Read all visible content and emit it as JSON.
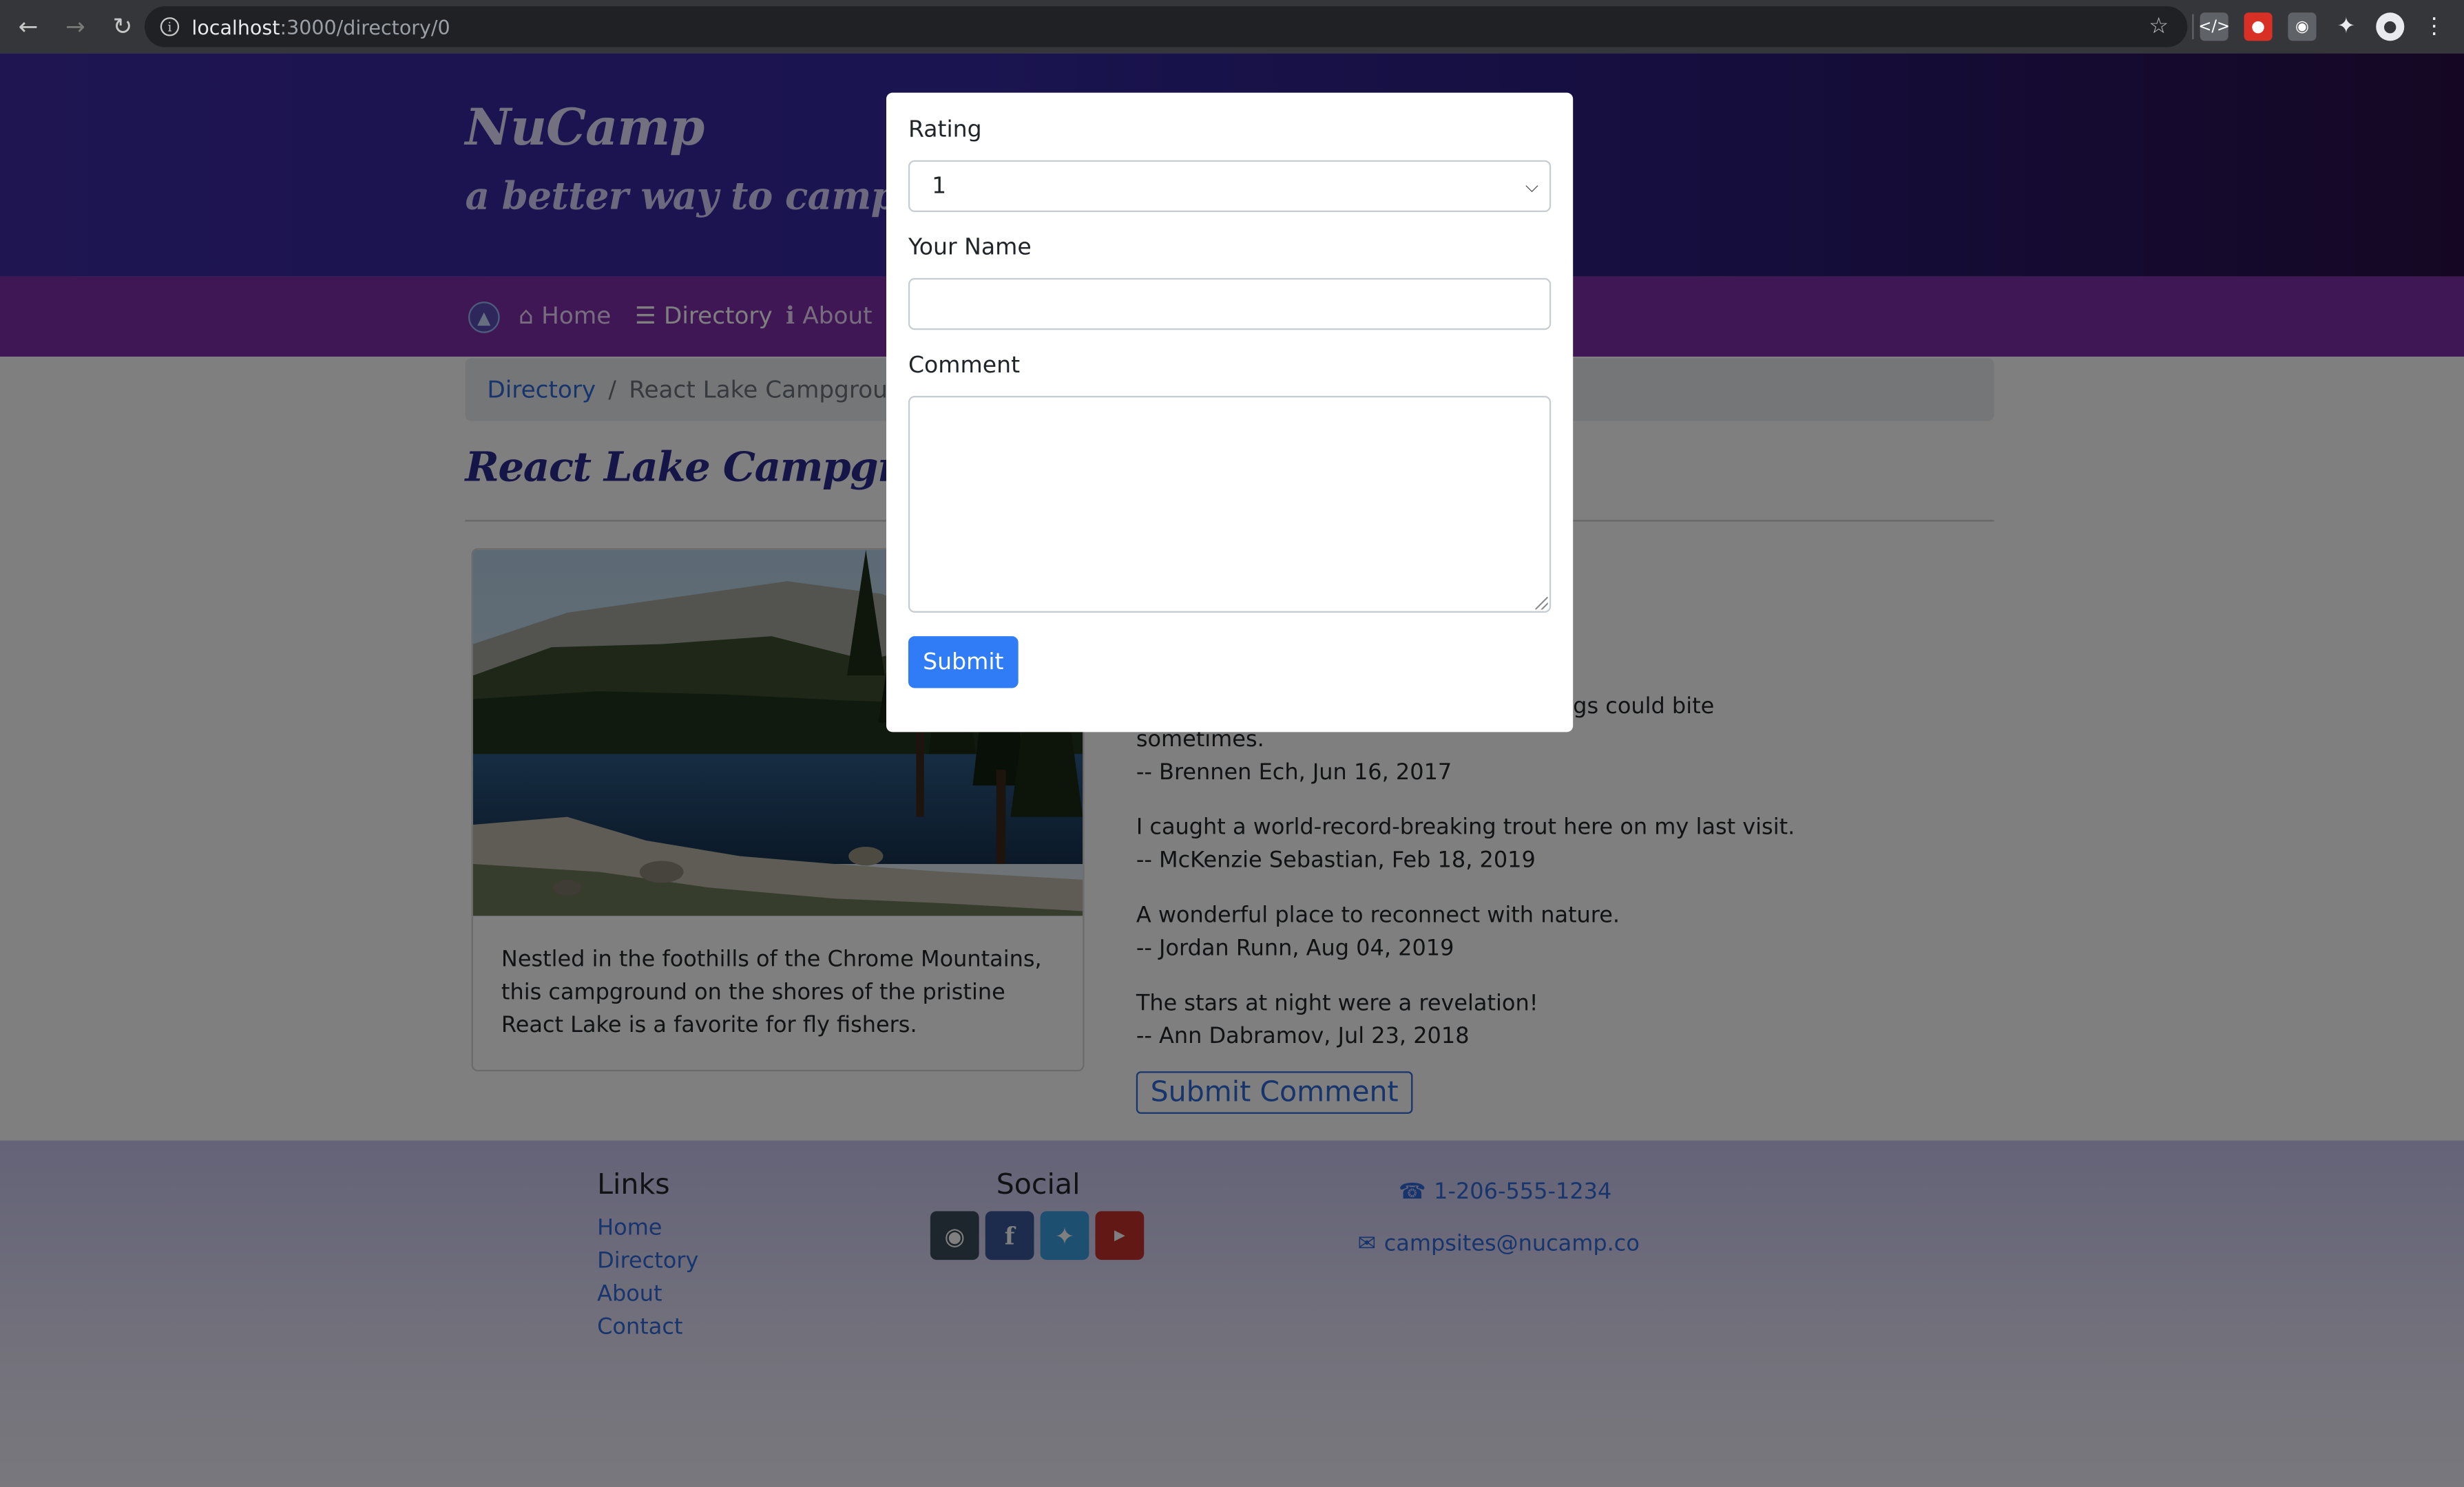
{
  "browser": {
    "url_host": "localhost",
    "url_path": ":3000/directory/0",
    "back_icon": "arrow-left-icon",
    "forward_icon": "arrow-right-icon",
    "reload_icon": "reload-icon",
    "bookmark_icon": "star-icon",
    "menu_icon": "kebab-menu-icon"
  },
  "header": {
    "brand": "NuCamp",
    "tagline": "a better way to camp"
  },
  "nav": {
    "items": [
      {
        "label": "Home",
        "icon": "home-icon"
      },
      {
        "label": "Directory",
        "icon": "list-icon",
        "active": true
      },
      {
        "label": "About",
        "icon": "info-icon"
      }
    ]
  },
  "breadcrumb": {
    "link": "Directory",
    "separator": "/",
    "current": "React Lake Campground"
  },
  "page": {
    "title": "React Lake Campground"
  },
  "campsite": {
    "description": "Nestled in the foothills of the Chrome Mountains, this campground on the shores of the pristine React Lake is a favorite for fly fishers."
  },
  "comments": {
    "partial_line_1": "gs could bite",
    "partial_line_2": "sometimes.",
    "items": [
      {
        "text": "",
        "author": "-- Brennen Ech, Jun 16, 2017"
      },
      {
        "text": "I caught a world-record-breaking trout here on my last visit.",
        "author": "-- McKenzie Sebastian, Feb 18, 2019"
      },
      {
        "text": "A wonderful place to reconnect with nature.",
        "author": "-- Jordan Runn, Aug 04, 2019"
      },
      {
        "text": "The stars at night were a revelation!",
        "author": "-- Ann Dabramov, Jul 23, 2018"
      }
    ],
    "submit_label": "Submit Comment"
  },
  "footer": {
    "links_heading": "Links",
    "links": [
      "Home",
      "Directory",
      "About",
      "Contact"
    ],
    "social_heading": "Social",
    "social": [
      "instagram-icon",
      "facebook-icon",
      "twitter-icon",
      "youtube-icon"
    ],
    "phone": "1-206-555-1234",
    "email": "campsites@nucamp.co"
  },
  "modal": {
    "rating_label": "Rating",
    "rating_value": "1",
    "name_label": "Your Name",
    "name_value": "",
    "comment_label": "Comment",
    "comment_value": "",
    "submit_label": "Submit"
  },
  "colors": {
    "link": "#2f6bd8",
    "navbar": "#7e2fa8",
    "jumbotron": "#3428a0",
    "title": "#2a2d8f",
    "primary_button": "#2f7cf6"
  }
}
